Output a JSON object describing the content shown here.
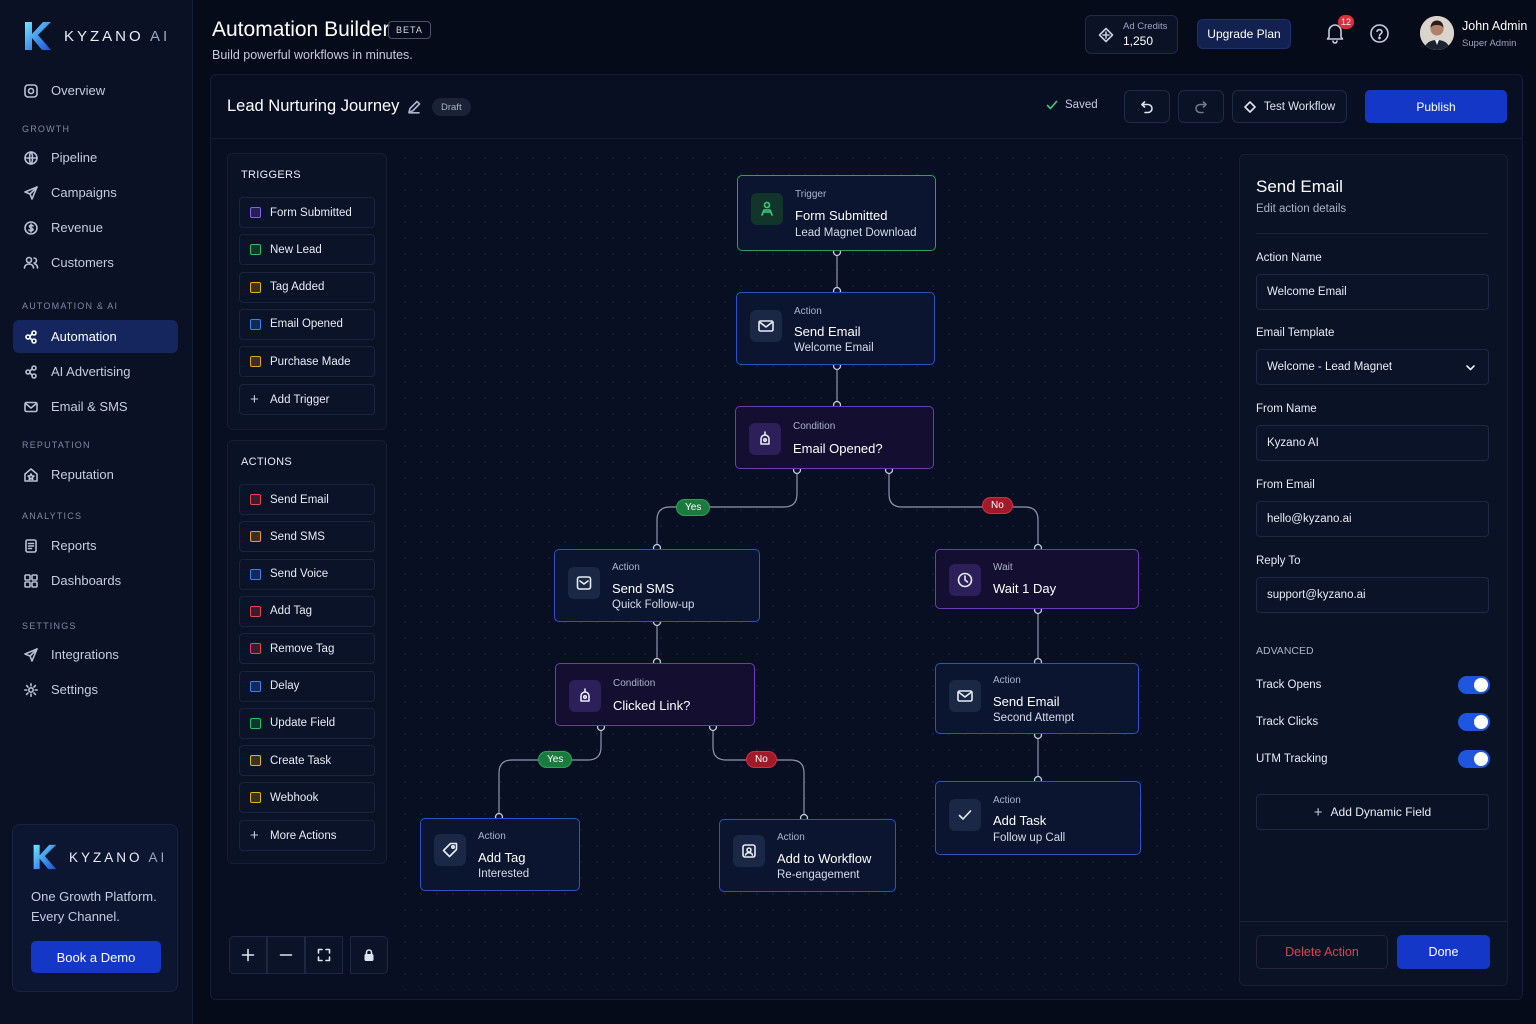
{
  "brand": {
    "name_main": "KYZANO",
    "name_suffix": "AI"
  },
  "nav": {
    "overview": "Overview",
    "sections": {
      "growth": "GROWTH",
      "automation": "AUTOMATION & AI",
      "reputation": "REPUTATION",
      "analytics": "ANALYTICS",
      "settings": "SETTINGS"
    },
    "items": {
      "pipeline": "Pipeline",
      "campaigns": "Campaigns",
      "revenue": "Revenue",
      "customers": "Customers",
      "automation": "Automation",
      "ai_advertising": "AI Advertising",
      "email_sms": "Email & SMS",
      "reputation": "Reputation",
      "reports": "Reports",
      "dashboards": "Dashboards",
      "integrations": "Integrations",
      "settings": "Settings"
    },
    "active": "automation"
  },
  "promo": {
    "tagline": "One Growth Platform. Every Channel.",
    "cta": "Book a Demo"
  },
  "header": {
    "title": "Automation Builder",
    "badge": "BETA",
    "subtitle": "Build powerful workflows in minutes.",
    "credits_label": "Ad Credits",
    "credits_value": "1,250",
    "upgrade": "Upgrade Plan",
    "notification_count": "12",
    "user_name": "John Admin",
    "user_role": "Super Admin"
  },
  "toolbar": {
    "workflow_name": "Lead Nurturing Journey",
    "status": "Draft",
    "saved": "Saved",
    "test": "Test Workflow",
    "publish": "Publish"
  },
  "palette": {
    "triggers_title": "TRIGGERS",
    "triggers": [
      {
        "label": "Form Submitted",
        "color": "#8b5cf6"
      },
      {
        "label": "New Lead",
        "color": "#22c55e"
      },
      {
        "label": "Tag Added",
        "color": "#eab308"
      },
      {
        "label": "Email Opened",
        "color": "#3b82f6"
      },
      {
        "label": "Purchase Made",
        "color": "#f59e0b"
      }
    ],
    "add_trigger": "Add Trigger",
    "actions_title": "ACTIONS",
    "actions": [
      {
        "label": "Send Email",
        "color": "#ef4444"
      },
      {
        "label": "Send SMS",
        "color": "#f59e0b"
      },
      {
        "label": "Send Voice",
        "color": "#3b82f6"
      },
      {
        "label": "Add Tag",
        "color": "#ef4444"
      },
      {
        "label": "Remove Tag",
        "color": "#ef4444"
      },
      {
        "label": "Delay",
        "color": "#3b82f6"
      },
      {
        "label": "Update Field",
        "color": "#22c55e"
      },
      {
        "label": "Create Task",
        "color": "#eab308"
      },
      {
        "label": "Webhook",
        "color": "#eab308"
      }
    ],
    "more_actions": "More Actions"
  },
  "workflow": {
    "trigger": {
      "kind": "Trigger",
      "title": "Form Submitted",
      "sub": "Lead Magnet Download"
    },
    "send_email": {
      "kind": "Action",
      "title": "Send Email",
      "sub": "Welcome Email"
    },
    "cond_opened": {
      "kind": "Condition",
      "title": "Email Opened?"
    },
    "send_sms": {
      "kind": "Action",
      "title": "Send SMS",
      "sub": "Quick Follow-up"
    },
    "wait": {
      "kind": "Wait",
      "title": "Wait 1 Day"
    },
    "cond_clicked": {
      "kind": "Condition",
      "title": "Clicked Link?"
    },
    "send_email2": {
      "kind": "Action",
      "title": "Send Email",
      "sub": "Second Attempt"
    },
    "add_tag": {
      "kind": "Action",
      "title": "Add Tag",
      "sub": "Interested"
    },
    "add_workflow": {
      "kind": "Action",
      "title": "Add to Workflow",
      "sub": "Re-engagement"
    },
    "add_task": {
      "kind": "Action",
      "title": "Add Task",
      "sub": "Follow up Call"
    },
    "yes": "Yes",
    "no": "No"
  },
  "panel": {
    "title": "Send Email",
    "subtitle": "Edit action details",
    "fields": {
      "action_name_label": "Action Name",
      "action_name": "Welcome Email",
      "template_label": "Email Template",
      "template": "Welcome - Lead Magnet",
      "from_name_label": "From Name",
      "from_name": "Kyzano AI",
      "from_email_label": "From Email",
      "from_email": "hello@kyzano.ai",
      "reply_to_label": "Reply To",
      "reply_to": "support@kyzano.ai"
    },
    "advanced_title": "ADVANCED",
    "toggles": [
      {
        "label": "Track Opens",
        "on": true
      },
      {
        "label": "Track Clicks",
        "on": true
      },
      {
        "label": "UTM Tracking",
        "on": true
      }
    ],
    "add_dynamic": "Add Dynamic Field",
    "delete": "Delete Action",
    "done": "Done"
  }
}
